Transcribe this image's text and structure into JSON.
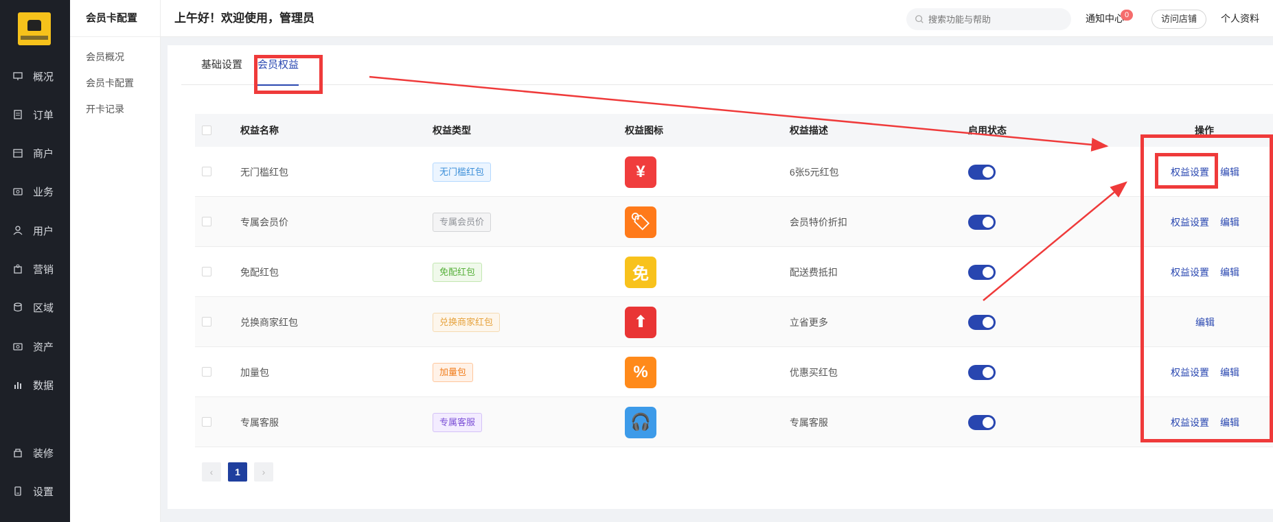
{
  "sidebar": {
    "items": [
      {
        "label": "概况",
        "icon": "presentation-icon"
      },
      {
        "label": "订单",
        "icon": "order-icon"
      },
      {
        "label": "商户",
        "icon": "merchant-icon"
      },
      {
        "label": "业务",
        "icon": "business-icon"
      },
      {
        "label": "用户",
        "icon": "user-icon"
      },
      {
        "label": "营销",
        "icon": "marketing-icon"
      },
      {
        "label": "区域",
        "icon": "region-icon"
      },
      {
        "label": "资产",
        "icon": "asset-icon"
      },
      {
        "label": "数据",
        "icon": "chart-icon"
      },
      {
        "label": "装修",
        "icon": "decoration-icon"
      },
      {
        "label": "设置",
        "icon": "settings-icon"
      }
    ]
  },
  "subsidebar": {
    "title": "会员卡配置",
    "items": [
      {
        "label": "会员概况"
      },
      {
        "label": "会员卡配置"
      },
      {
        "label": "开卡记录"
      }
    ]
  },
  "header": {
    "greeting": "上午好！欢迎使用，管理员",
    "search_placeholder": "搜索功能与帮助",
    "notice_label": "通知中心",
    "notice_count": "0",
    "visit_label": "访问店铺",
    "profile_label": "个人资料"
  },
  "tabs": [
    {
      "label": "基础设置",
      "active": false
    },
    {
      "label": "会员权益",
      "active": true
    }
  ],
  "table": {
    "headers": [
      "权益名称",
      "权益类型",
      "权益图标",
      "权益描述",
      "启用状态",
      "操作"
    ],
    "rows": [
      {
        "name": "无门槛红包",
        "type": "无门槛红包",
        "type_color": "#3b8ed8",
        "type_bg": "#ecf5ff",
        "type_border": "#b3d8ff",
        "icon_glyph": "¥",
        "icon_bg": "#f03d3d",
        "desc": "6张5元红包",
        "enabled": true,
        "setting_label": "权益设置",
        "edit_label": "编辑"
      },
      {
        "name": "专属会员价",
        "type": "专属会员价",
        "type_color": "#909399",
        "type_bg": "#f4f4f5",
        "type_border": "#d3d4d6",
        "icon_glyph": "🏷",
        "icon_bg": "#ff7a1a",
        "desc": "会员特价折扣",
        "enabled": true,
        "setting_label": "权益设置",
        "edit_label": "编辑"
      },
      {
        "name": "免配红包",
        "type": "免配红包",
        "type_color": "#56b03a",
        "type_bg": "#f0f9eb",
        "type_border": "#c2e7b0",
        "icon_glyph": "免",
        "icon_bg": "#f8c21c",
        "desc": "配送费抵扣",
        "enabled": true,
        "setting_label": "权益设置",
        "edit_label": "编辑"
      },
      {
        "name": "兑换商家红包",
        "type": "兑换商家红包",
        "type_color": "#e6a23c",
        "type_bg": "#fdf6ec",
        "type_border": "#f5dab1",
        "icon_glyph": "⬆",
        "icon_bg": "#e93535",
        "desc": "立省更多",
        "enabled": true,
        "setting_label": "",
        "edit_label": "编辑"
      },
      {
        "name": "加量包",
        "type": "加量包",
        "type_color": "#f07c1a",
        "type_bg": "#fff2e8",
        "type_border": "#ffc69b",
        "icon_glyph": "%",
        "icon_bg": "#ff8a1a",
        "desc": "优惠买红包",
        "enabled": true,
        "setting_label": "权益设置",
        "edit_label": "编辑"
      },
      {
        "name": "专属客服",
        "type": "专属客服",
        "type_color": "#7b4fd6",
        "type_bg": "#f3ecff",
        "type_border": "#d4c1f7",
        "icon_glyph": "🎧",
        "icon_bg": "#3d9be9",
        "desc": "专属客服",
        "enabled": true,
        "setting_label": "权益设置",
        "edit_label": "编辑"
      }
    ]
  },
  "pagination": {
    "prev": "‹",
    "current": "1",
    "next": "›"
  },
  "colors": {
    "accent": "#2846b0",
    "annotation_red": "#ef3a3a"
  }
}
